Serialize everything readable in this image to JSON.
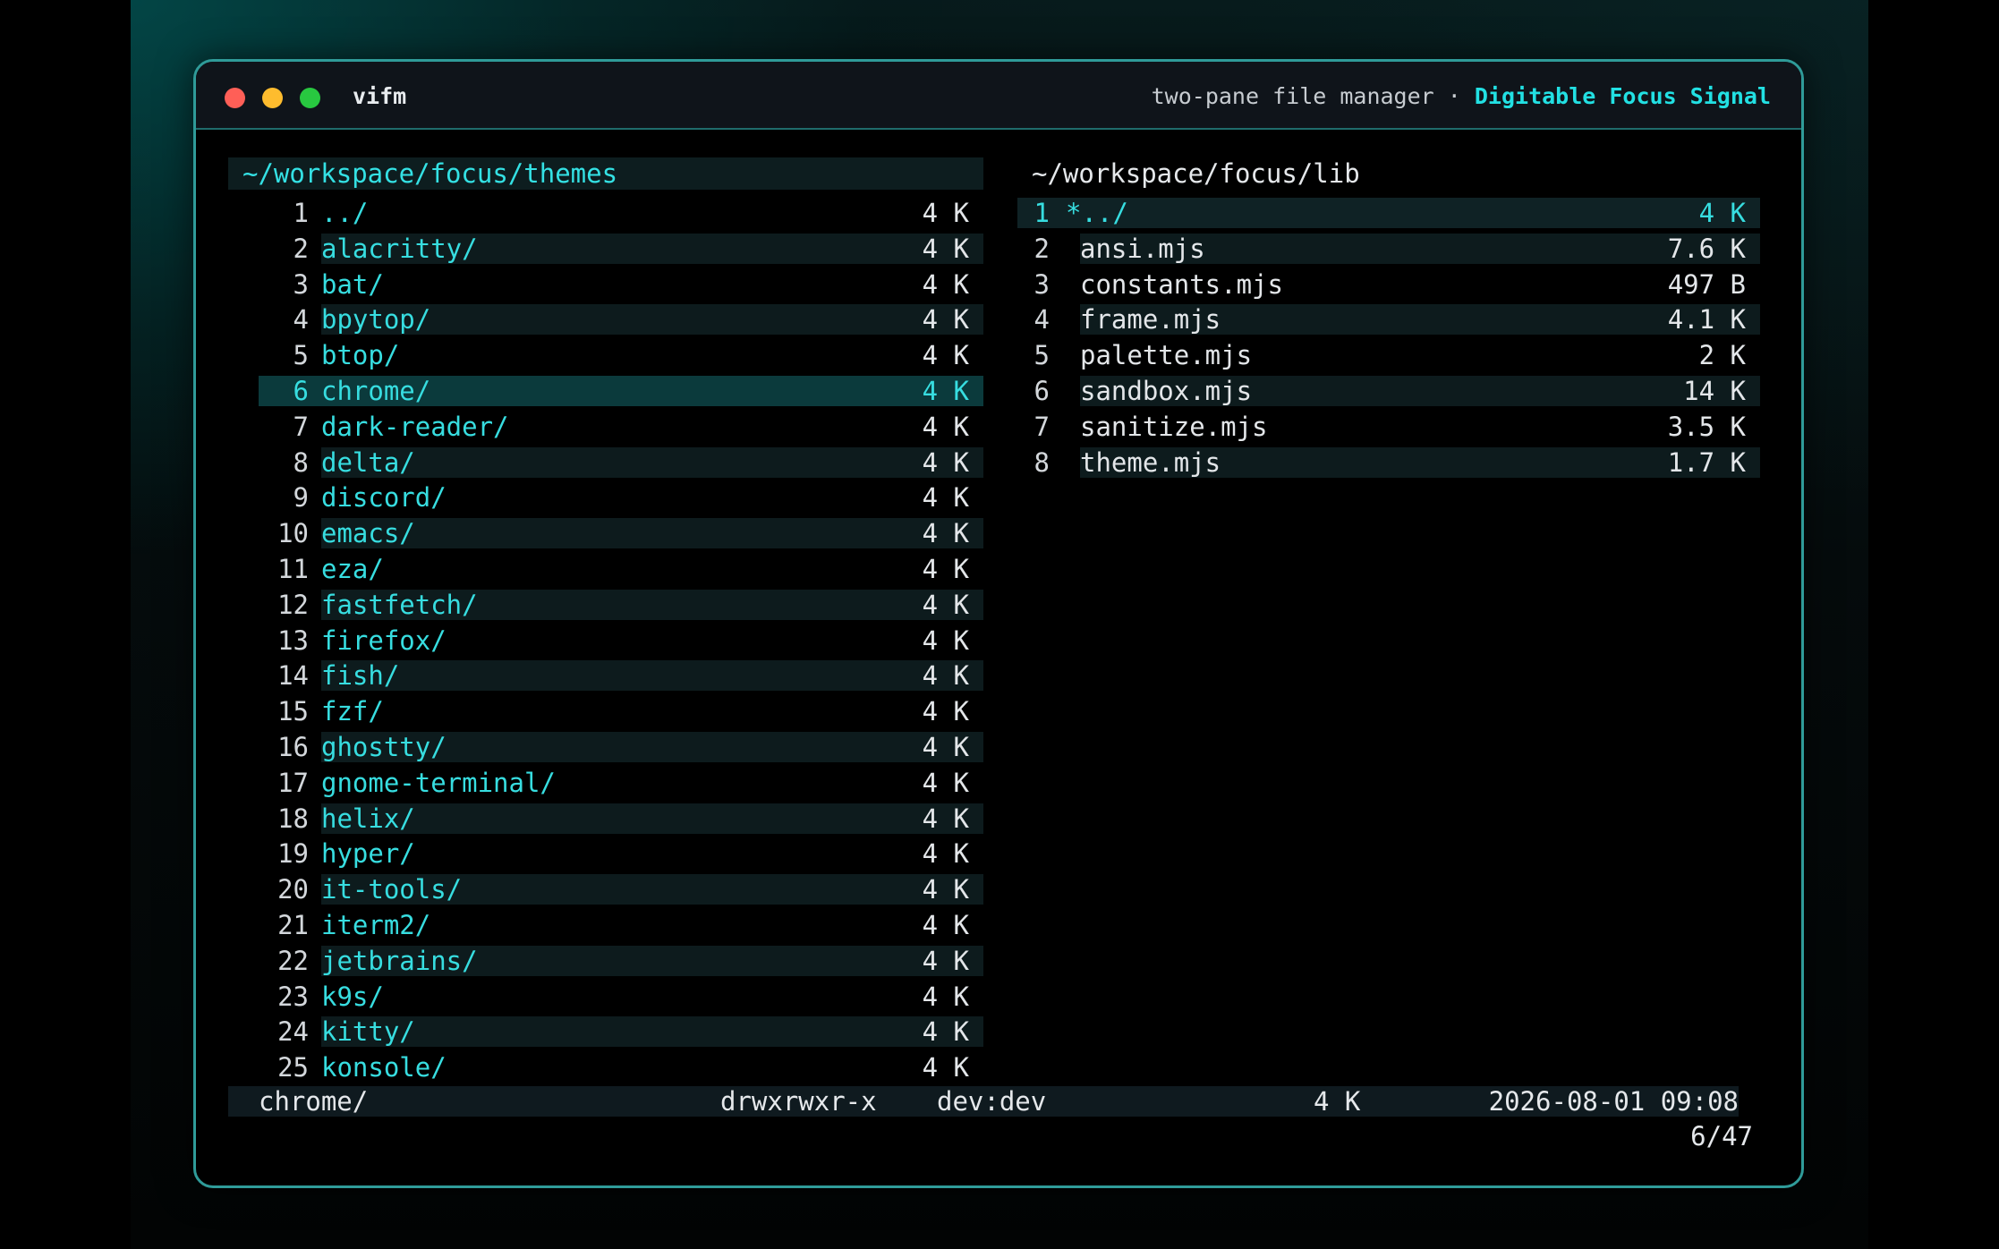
{
  "window": {
    "app_title": "vifm",
    "subtitle": "two-pane file manager",
    "separator": " · ",
    "brand": "Digitable Focus Signal"
  },
  "left_pane": {
    "path": "~/workspace/focus/themes",
    "cursor_index": 5,
    "entries": [
      {
        "num": "1",
        "name": "../",
        "size": "4 K"
      },
      {
        "num": "2",
        "name": "alacritty/",
        "size": "4 K"
      },
      {
        "num": "3",
        "name": "bat/",
        "size": "4 K"
      },
      {
        "num": "4",
        "name": "bpytop/",
        "size": "4 K"
      },
      {
        "num": "5",
        "name": "btop/",
        "size": "4 K"
      },
      {
        "num": "6",
        "name": "chrome/",
        "size": "4 K"
      },
      {
        "num": "7",
        "name": "dark-reader/",
        "size": "4 K"
      },
      {
        "num": "8",
        "name": "delta/",
        "size": "4 K"
      },
      {
        "num": "9",
        "name": "discord/",
        "size": "4 K"
      },
      {
        "num": "10",
        "name": "emacs/",
        "size": "4 K"
      },
      {
        "num": "11",
        "name": "eza/",
        "size": "4 K"
      },
      {
        "num": "12",
        "name": "fastfetch/",
        "size": "4 K"
      },
      {
        "num": "13",
        "name": "firefox/",
        "size": "4 K"
      },
      {
        "num": "14",
        "name": "fish/",
        "size": "4 K"
      },
      {
        "num": "15",
        "name": "fzf/",
        "size": "4 K"
      },
      {
        "num": "16",
        "name": "ghostty/",
        "size": "4 K"
      },
      {
        "num": "17",
        "name": "gnome-terminal/",
        "size": "4 K"
      },
      {
        "num": "18",
        "name": "helix/",
        "size": "4 K"
      },
      {
        "num": "19",
        "name": "hyper/",
        "size": "4 K"
      },
      {
        "num": "20",
        "name": "it-tools/",
        "size": "4 K"
      },
      {
        "num": "21",
        "name": "iterm2/",
        "size": "4 K"
      },
      {
        "num": "22",
        "name": "jetbrains/",
        "size": "4 K"
      },
      {
        "num": "23",
        "name": "k9s/",
        "size": "4 K"
      },
      {
        "num": "24",
        "name": "kitty/",
        "size": "4 K"
      },
      {
        "num": "25",
        "name": "konsole/",
        "size": "4 K"
      }
    ]
  },
  "right_pane": {
    "path": "~/workspace/focus/lib",
    "current_index": 0,
    "entries": [
      {
        "num": "1",
        "name": "*../",
        "size": "4 K"
      },
      {
        "num": "2",
        "name": "ansi.mjs",
        "size": "7.6 K"
      },
      {
        "num": "3",
        "name": "constants.mjs",
        "size": "497 B"
      },
      {
        "num": "4",
        "name": "frame.mjs",
        "size": "4.1 K"
      },
      {
        "num": "5",
        "name": "palette.mjs",
        "size": "2 K"
      },
      {
        "num": "6",
        "name": "sandbox.mjs",
        "size": "14 K"
      },
      {
        "num": "7",
        "name": "sanitize.mjs",
        "size": "3.5 K"
      },
      {
        "num": "8",
        "name": "theme.mjs",
        "size": "1.7 K"
      }
    ]
  },
  "statusbar": {
    "name": "chrome/",
    "permissions": "drwxrwxr-x",
    "owner": "dev:dev",
    "size": "4 K",
    "modified": "2026-08-01 09:08",
    "position": "6/47"
  },
  "colors": {
    "accent": "#22e0e3",
    "frame": "#2f9b99",
    "background": "#000000"
  }
}
